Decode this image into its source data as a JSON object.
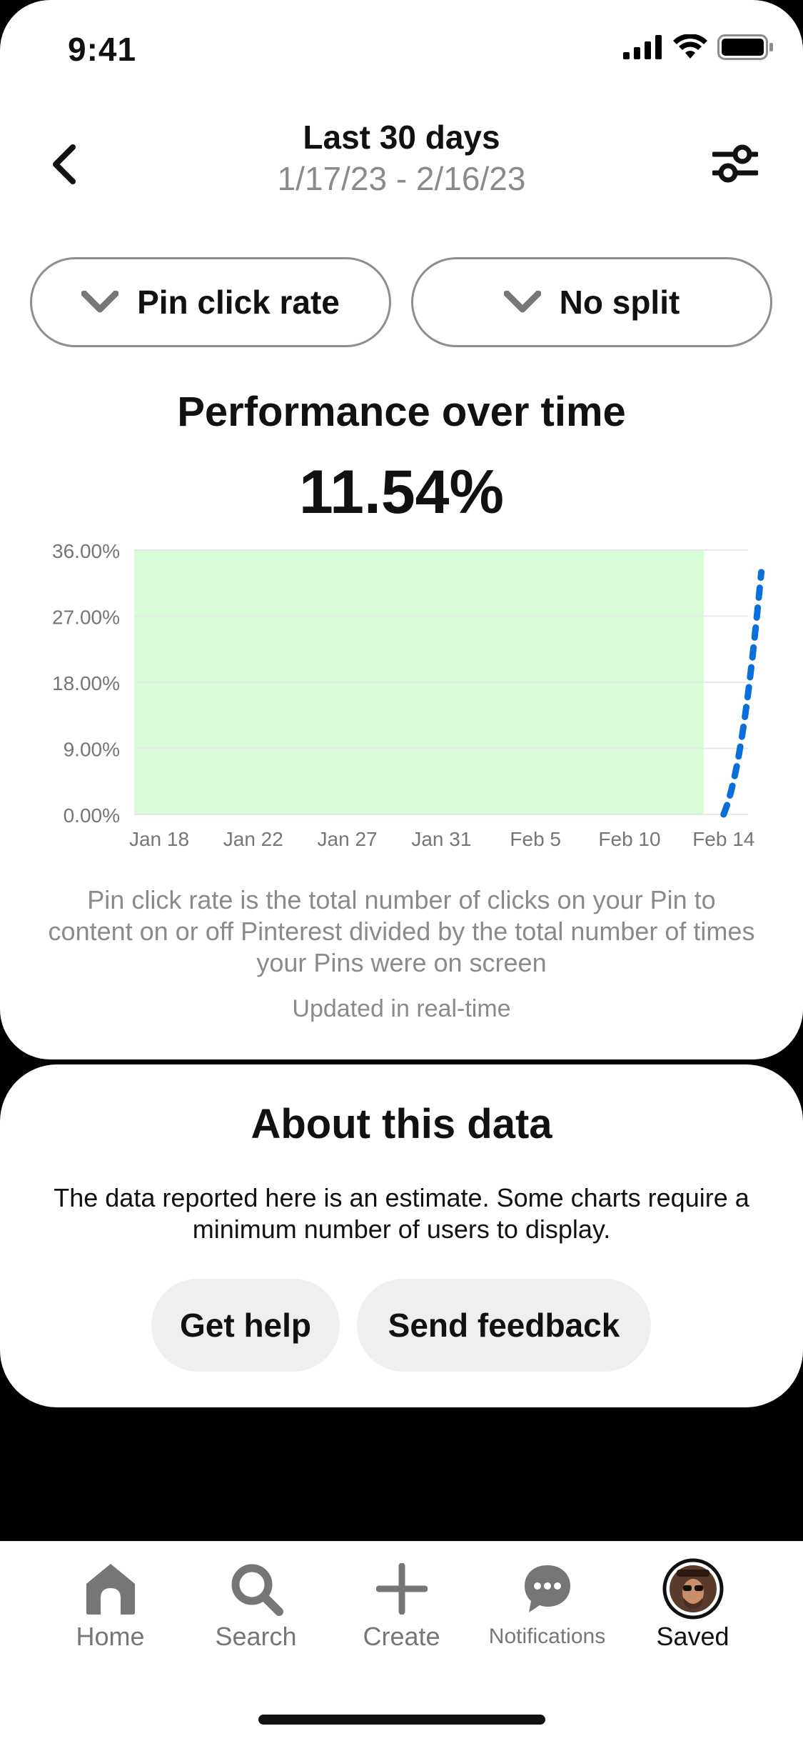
{
  "status_bar": {
    "time": "9:41"
  },
  "header": {
    "title": "Last 30 days",
    "date_range": "1/17/23 - 2/16/23"
  },
  "filters": {
    "metric": "Pin click rate",
    "split": "No split"
  },
  "performance": {
    "title": "Performance over time",
    "value": "11.54%"
  },
  "chart_data": {
    "type": "line",
    "y_ticks": [
      "36.00%",
      "27.00%",
      "18.00%",
      "9.00%",
      "0.00%"
    ],
    "x_ticks": [
      "Jan 18",
      "Jan 22",
      "Jan 27",
      "Jan 31",
      "Feb 5",
      "Feb 10",
      "Feb 14"
    ],
    "ylim": [
      0,
      36
    ],
    "highlight_region": {
      "from": "Jan 18",
      "to": "Feb 14",
      "color": "#d9fdd9"
    },
    "series": [
      {
        "style": "dashed",
        "color": "#0a6fdb",
        "points": [
          {
            "x": "Feb 14",
            "y": 0
          },
          {
            "x": "Feb 16",
            "y": 33
          }
        ]
      }
    ],
    "grid": true
  },
  "description": "Pin click rate is the total number of clicks on your Pin to content on or off Pinterest divided by the total number of times your Pins were on screen",
  "updated_text": "Updated in real-time",
  "about": {
    "title": "About this data",
    "text": "The data reported here is an estimate. Some charts require a minimum number of users to display.",
    "help_label": "Get help",
    "feedback_label": "Send feedback"
  },
  "nav": {
    "home": "Home",
    "search": "Search",
    "create": "Create",
    "notifications": "Notifications",
    "saved": "Saved"
  },
  "colors": {
    "accent_line": "#0a6fdb",
    "highlight": "#d9fdd9",
    "muted_text": "#8a8a8a",
    "button_bg": "#efefef"
  }
}
